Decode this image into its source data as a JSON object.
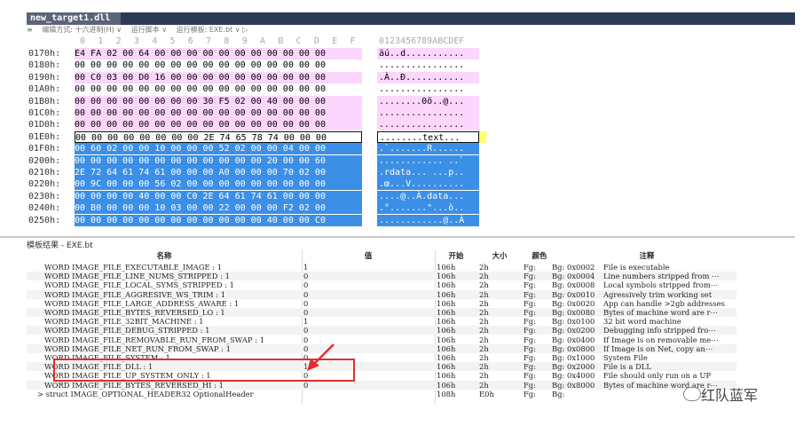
{
  "tab": {
    "label": "new_target1.dll ×"
  },
  "toolbar": {
    "edit_mode": "编辑方式: 十六进制(H) ∨",
    "run_script": "运行脚本 ∨",
    "run_template": "运行模板: EXE.bt ∨ ▷"
  },
  "hex_header": {
    "columns": [
      "0",
      "1",
      "2",
      "3",
      "4",
      "5",
      "6",
      "7",
      "8",
      "9",
      "A",
      "B",
      "C",
      "D",
      "E",
      "F"
    ],
    "ascii_header": "0123456789ABCDEF"
  },
  "hex_rows": [
    {
      "addr": "0170h:",
      "bytes": "E4 FA 02 00 64 00 00 00 00 00 00 00 00 00 00 00",
      "ascii": "äú..d..........."
    },
    {
      "addr": "0180h:",
      "bytes": "00 00 00 00 00 00 00 00 00 00 00 00 00 00 00 00",
      "ascii": "................"
    },
    {
      "addr": "0190h:",
      "bytes": "00 C0 03 00 D0 16 00 00 00 00 00 00 00 00 00 00",
      "ascii": ".À..Ð..........."
    },
    {
      "addr": "01A0h:",
      "bytes": "00 00 00 00 00 00 00 00 00 00 00 00 00 00 00 00",
      "ascii": "................"
    },
    {
      "addr": "01B0h:",
      "bytes": "00 00 00 00 00 00 00 00 30 F5 02 00 40 00 00 00",
      "ascii": "........0õ..@..."
    },
    {
      "addr": "01C0h:",
      "bytes": "00 00 00 00 00 00 00 00 00 00 00 00 00 00 00 00",
      "ascii": "................"
    },
    {
      "addr": "01D0h:",
      "bytes": "00 00 00 00 00 00 00 00 00 00 00 00 00 00 00 00",
      "ascii": "................"
    },
    {
      "addr": "01E0h:",
      "bytes": "00 00 00 00 00 00 00 00 2E 74 65 78 74 00 00 00",
      "ascii": "........text..."
    },
    {
      "addr": "01F0h:",
      "bytes": "00 60 02 00 00 10 00 00 00 52 02 00 00 04 00 00",
      "ascii": ".`.......R......"
    },
    {
      "addr": "0200h:",
      "bytes": "00 00 00 00 00 00 00 00 00 00 00 00 20 00 00 60",
      "ascii": "............ ..`"
    },
    {
      "addr": "0210h:",
      "bytes": "2E 72 64 61 74 61 00 00 00 A0 00 00 00 70 02 00",
      "ascii": ".rdata... ...p.."
    },
    {
      "addr": "0220h:",
      "bytes": "00 9C 00 00 00 56 02 00 00 00 00 00 00 00 00 00",
      "ascii": ".œ...V.........."
    },
    {
      "addr": "0230h:",
      "bytes": "00 00 00 00 40 00 00 C0 2E 64 61 74 61 00 00 00",
      "ascii": "....@..À.data..."
    },
    {
      "addr": "0240h:",
      "bytes": "00 B0 00 00 00 10 03 00 00 22 00 00 00 F2 02 00",
      "ascii": ".°.......\"...ò.."
    },
    {
      "addr": "0250h:",
      "bytes": "00 00 00 00 00 00 00 00 00 00 00 00 40 00 00 C0",
      "ascii": "............@..À"
    }
  ],
  "template_panel": {
    "title": "模板结果 - EXE.bt",
    "headers": {
      "name": "名称",
      "value": "值",
      "start": "开始",
      "size": "大小",
      "color": "颜色",
      "comment": "注释"
    },
    "rows": [
      {
        "name": "WORD IMAGE_FILE_EXECUTABLE_IMAGE : 1",
        "value": "1",
        "start": "106h",
        "size": "2h",
        "fg": "Fg:",
        "bg": "Bg: 0x0002",
        "comment": "File is executable"
      },
      {
        "name": "WORD IMAGE_FILE_LINE_NUMS_STRIPPED : 1",
        "value": "0",
        "start": "106h",
        "size": "2h",
        "fg": "Fg:",
        "bg": "Bg: 0x0004",
        "comment": "Line numbers stripped from ⋯"
      },
      {
        "name": "WORD IMAGE_FILE_LOCAL_SYMS_STRIPPED : 1",
        "value": "0",
        "start": "106h",
        "size": "2h",
        "fg": "Fg:",
        "bg": "Bg: 0x0008",
        "comment": "Local symbols stripped from⋯"
      },
      {
        "name": "WORD IMAGE_FILE_AGGRESIVE_WS_TRIM : 1",
        "value": "0",
        "start": "106h",
        "size": "2h",
        "fg": "Fg:",
        "bg": "Bg: 0x0010",
        "comment": "Agressively trim working set"
      },
      {
        "name": "WORD IMAGE_FILE_LARGE_ADDRESS_AWARE : 1",
        "value": "0",
        "start": "106h",
        "size": "2h",
        "fg": "Fg:",
        "bg": "Bg: 0x0020",
        "comment": "App can handle >2gb addresses"
      },
      {
        "name": "WORD IMAGE_FILE_BYTES_REVERSED_LO : 1",
        "value": "0",
        "start": "106h",
        "size": "2h",
        "fg": "Fg:",
        "bg": "Bg: 0x0080",
        "comment": "Bytes of machine word are r⋯"
      },
      {
        "name": "WORD IMAGE_FILE_32BIT_MACHINE : 1",
        "value": "1",
        "start": "106h",
        "size": "2h",
        "fg": "Fg:",
        "bg": "Bg: 0x0100",
        "comment": "32 bit word machine"
      },
      {
        "name": "WORD IMAGE_FILE_DEBUG_STRIPPED : 1",
        "value": "0",
        "start": "106h",
        "size": "2h",
        "fg": "Fg:",
        "bg": "Bg: 0x0200",
        "comment": "Debugging info stripped fro⋯"
      },
      {
        "name": "WORD IMAGE_FILE_REMOVABLE_RUN_FROM_SWAP : 1",
        "value": "0",
        "start": "106h",
        "size": "2h",
        "fg": "Fg:",
        "bg": "Bg: 0x0400",
        "comment": "If Image is on removable me⋯"
      },
      {
        "name": "WORD IMAGE_FILE_NET_RUN_FROM_SWAP : 1",
        "value": "0",
        "start": "106h",
        "size": "2h",
        "fg": "Fg:",
        "bg": "Bg: 0x0800",
        "comment": "If Image is on Net, copy an⋯"
      },
      {
        "name": "WORD IMAGE_FILE_SYSTEM : 1",
        "value": "0",
        "start": "106h",
        "size": "2h",
        "fg": "Fg:",
        "bg": "Bg: 0x1000",
        "comment": "System File"
      },
      {
        "name": "WORD IMAGE_FILE_DLL : 1",
        "value": "1",
        "start": "106h",
        "size": "2h",
        "fg": "Fg:",
        "bg": "Bg: 0x2000",
        "comment": "File is a DLL"
      },
      {
        "name": "WORD IMAGE_FILE_UP_SYSTEM_ONLY : 1",
        "value": "0",
        "start": "106h",
        "size": "2h",
        "fg": "Fg:",
        "bg": "Bg: 0x4000",
        "comment": "File should only run on a UP"
      },
      {
        "name": "WORD IMAGE_FILE_BYTES_REVERSED_HI : 1",
        "value": "0",
        "start": "106h",
        "size": "2h",
        "fg": "Fg:",
        "bg": "Bg: 0x8000",
        "comment": "Bytes of machine word are r⋯"
      },
      {
        "name": "> struct IMAGE_OPTIONAL_HEADER32 OptionalHeader",
        "value": "",
        "start": "108h",
        "size": "E0h",
        "fg": "Fg:",
        "bg": "Bg:",
        "comment": ""
      }
    ]
  },
  "watermark": {
    "text": "红队蓝军",
    "icon": "wechat-icon"
  },
  "colors": {
    "selection_blue": "#3c8fe6",
    "pink": "#fcd6fc",
    "highlight_red": "#e52d2d",
    "tab_bg": "#5b6478"
  }
}
